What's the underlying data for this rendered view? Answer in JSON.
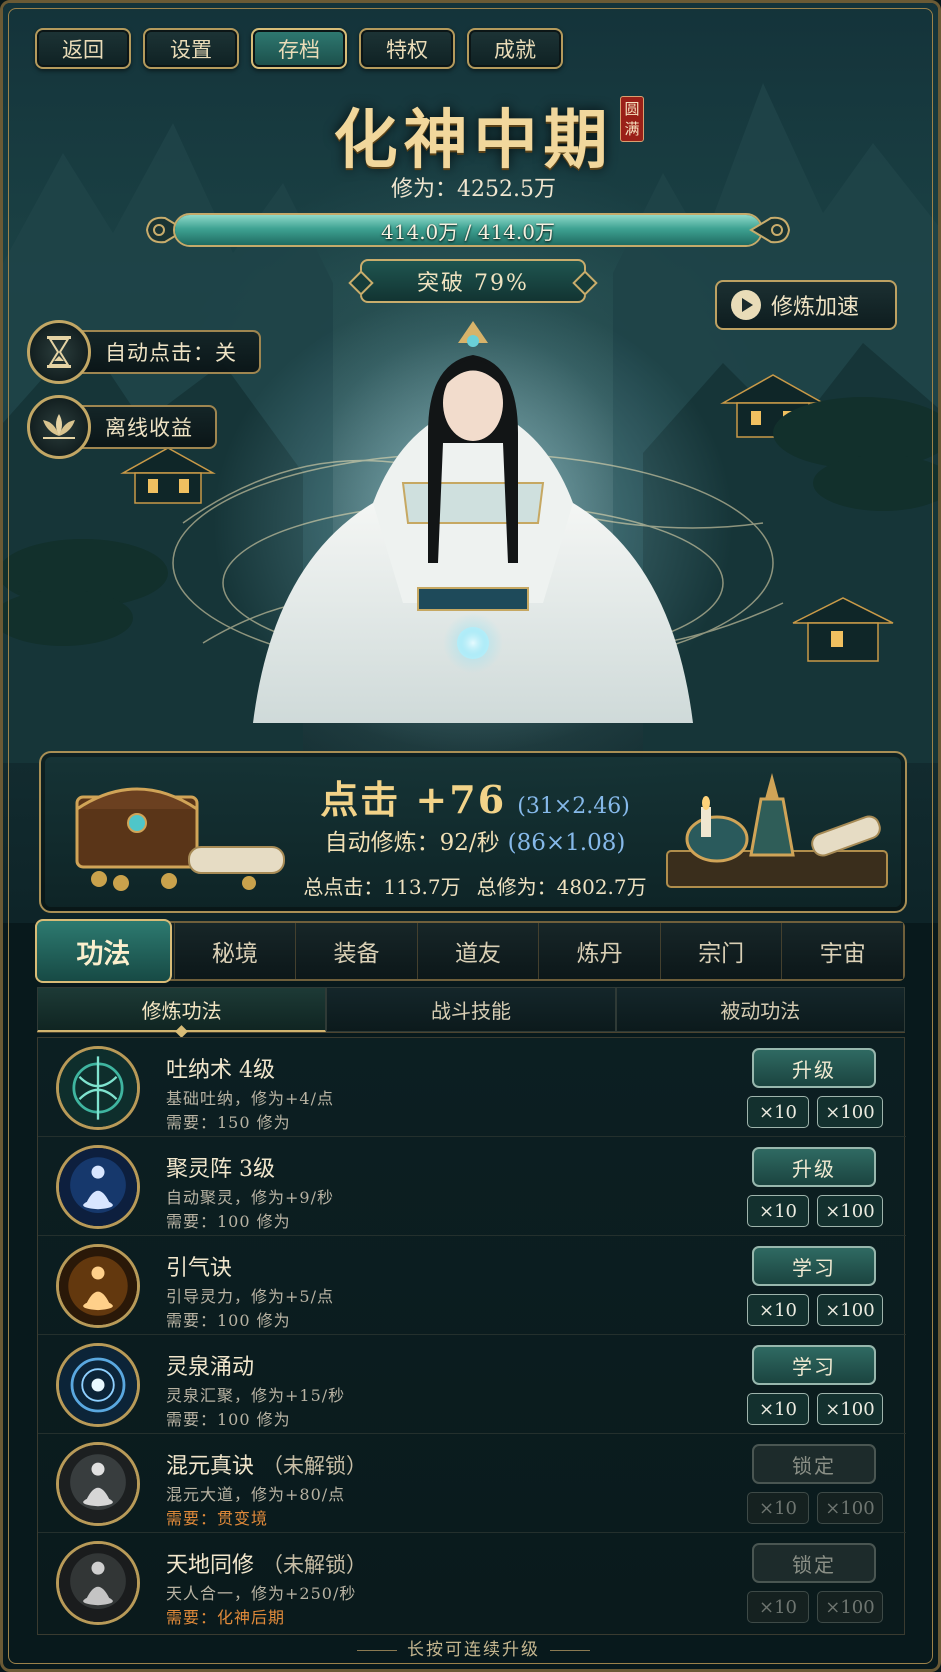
{
  "top_nav": [
    {
      "label": "返回",
      "active": false
    },
    {
      "label": "设置",
      "active": false
    },
    {
      "label": "存档",
      "active": true
    },
    {
      "label": "特权",
      "active": false
    },
    {
      "label": "成就",
      "active": false
    }
  ],
  "realm": {
    "title": "化神中期",
    "seal": "圆满"
  },
  "cultivation": {
    "label": "修为：4252.5万"
  },
  "progress": {
    "text": "414.0万 / 414.0万",
    "fraction": 1.0
  },
  "breakthrough": {
    "label": "突破 79%"
  },
  "speedup": {
    "label": "修炼加速",
    "icon": "play-icon"
  },
  "side_buttons": [
    {
      "label": "自动点击：关",
      "icon": "hourglass-icon"
    },
    {
      "label": "离线收益",
      "icon": "lotus-icon"
    }
  ],
  "stats": {
    "click": "点击 +76",
    "click_mult": "(31×2.46)",
    "auto": "自动修炼：92/秒",
    "auto_mult": "(86×1.08)",
    "total_click": "总点击：113.7万",
    "total_cult": "总修为：4802.7万"
  },
  "tabs": [
    {
      "label": "功法",
      "active": true
    },
    {
      "label": "秘境",
      "active": false
    },
    {
      "label": "装备",
      "active": false
    },
    {
      "label": "道友",
      "active": false
    },
    {
      "label": "炼丹",
      "active": false
    },
    {
      "label": "宗门",
      "active": false
    },
    {
      "label": "宇宙",
      "active": false
    }
  ],
  "subtabs": [
    {
      "label": "修炼功法",
      "active": true
    },
    {
      "label": "战斗技能",
      "active": false
    },
    {
      "label": "被动功法",
      "active": false
    }
  ],
  "skills": [
    {
      "name": "吐纳术 4级",
      "lock": "",
      "desc": "基础吐纳，修为+4/点",
      "req": "需要：150 修为",
      "req_warn": false,
      "action": "升级",
      "disabled": false,
      "x10": "×10",
      "x100": "×100",
      "color": "#3fb5a0"
    },
    {
      "name": "聚灵阵 3级",
      "lock": "",
      "desc": "自动聚灵，修为+9/秒",
      "req": "需要：100 修为",
      "req_warn": false,
      "action": "升级",
      "disabled": false,
      "x10": "×10",
      "x100": "×100",
      "color": "#4a86d6"
    },
    {
      "name": "引气诀",
      "lock": "",
      "desc": "引导灵力，修为+5/点",
      "req": "需要：100 修为",
      "req_warn": false,
      "action": "学习",
      "disabled": false,
      "x10": "×10",
      "x100": "×100",
      "color": "#d99a3a"
    },
    {
      "name": "灵泉涌动",
      "lock": "",
      "desc": "灵泉汇聚，修为+15/秒",
      "req": "需要：100 修为",
      "req_warn": false,
      "action": "学习",
      "disabled": false,
      "x10": "×10",
      "x100": "×100",
      "color": "#5aa8e0"
    },
    {
      "name": "混元真诀",
      "lock": "（未解锁）",
      "desc": "混元大道，修为+80/点",
      "req": "需要：贯变境",
      "req_warn": true,
      "action": "锁定",
      "disabled": true,
      "x10": "×10",
      "x100": "×100",
      "color": "#9a9a9a"
    },
    {
      "name": "天地同修",
      "lock": "（未解锁）",
      "desc": "天人合一，修为+250/秒",
      "req": "需要：化神后期",
      "req_warn": true,
      "action": "锁定",
      "disabled": true,
      "x10": "×10",
      "x100": "×100",
      "color": "#8a8a8a"
    }
  ],
  "hint": "长按可连续升级"
}
